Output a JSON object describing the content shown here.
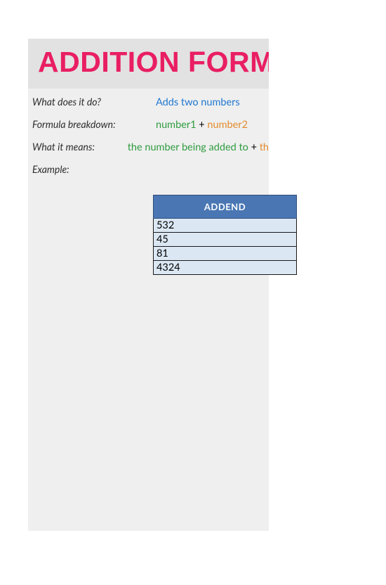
{
  "title": "ADDITION FORMULA",
  "rows": {
    "whatDoes": {
      "label": "What does it do?",
      "value": "Adds two numbers"
    },
    "breakdown": {
      "label": "Formula breakdown:",
      "part1": "number1",
      "op": " + ",
      "part2": "number2"
    },
    "means": {
      "label": "What it means:",
      "part1": "the number being added to",
      "op": " + ",
      "part2": "th"
    },
    "example": {
      "label": "Example:"
    }
  },
  "table": {
    "header": "ADDEND",
    "cells": [
      "532",
      "45",
      "81",
      "4324"
    ]
  }
}
